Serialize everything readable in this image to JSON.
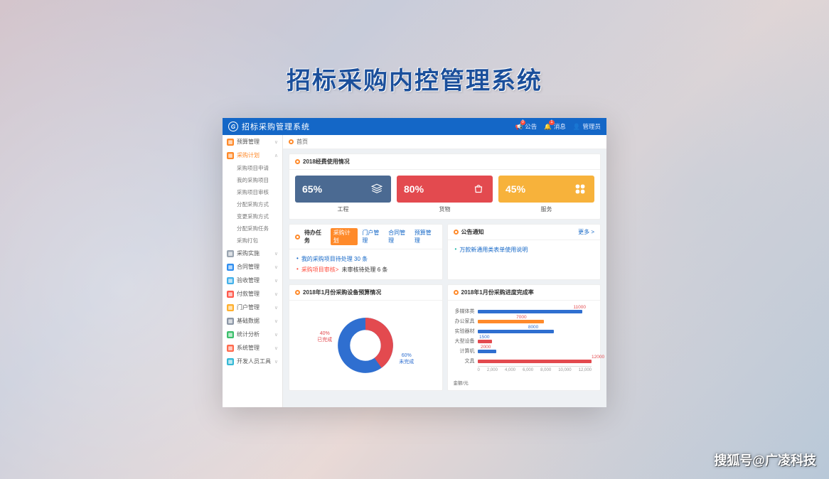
{
  "page_title": "招标采购内控管理系统",
  "watermark": "搜狐号@广凌科技",
  "titlebar": {
    "app_name": "招标采购管理系统",
    "notice": "公告",
    "notice_badge": "0",
    "msg": "消息",
    "msg_badge": "1",
    "user": "管理员"
  },
  "sidebar": {
    "items": [
      {
        "label": "预算管理",
        "icon_bg": "#ff8a2a",
        "chev": "∨"
      },
      {
        "label": "采购计划",
        "icon_bg": "#ff8a2a",
        "chev": "∧",
        "active": true,
        "children": [
          {
            "label": "采购项目申请"
          },
          {
            "label": "我的采购项目"
          },
          {
            "label": "采购项目审核"
          },
          {
            "label": "分配采购方式"
          },
          {
            "label": "变更采购方式"
          },
          {
            "label": "分配采购任务"
          },
          {
            "label": "采购打包"
          }
        ]
      },
      {
        "label": "采购实施",
        "icon_bg": "#9aa5b1",
        "chev": "∨"
      },
      {
        "label": "合同管理",
        "icon_bg": "#2f8ef0",
        "chev": "∨"
      },
      {
        "label": "验收管理",
        "icon_bg": "#44b1ea",
        "chev": "∨"
      },
      {
        "label": "付款管理",
        "icon_bg": "#ff5a4d",
        "chev": "∨"
      },
      {
        "label": "门户管理",
        "icon_bg": "#ffb02e",
        "chev": "∨"
      },
      {
        "label": "基础数据",
        "icon_bg": "#8c97a6",
        "chev": "∨"
      },
      {
        "label": "统计分析",
        "icon_bg": "#3bbf6b",
        "chev": "∨"
      },
      {
        "label": "系统管理",
        "icon_bg": "#ff6a4d",
        "chev": "∨"
      },
      {
        "label": "开发人员工具",
        "icon_bg": "#35b9d6",
        "chev": "∨"
      }
    ]
  },
  "crumb": "首页",
  "usage": {
    "title": "2018经费使用情况",
    "items": [
      {
        "pct": "65%",
        "label": "工程",
        "bg": "#4b6a92"
      },
      {
        "pct": "80%",
        "label": "货物",
        "bg": "#e34a4f"
      },
      {
        "pct": "45%",
        "label": "服务",
        "bg": "#f7b23b"
      }
    ]
  },
  "tasks": {
    "head": "待办任务",
    "tabs": [
      "采购计划",
      "门户管理",
      "合同管理",
      "预算管理"
    ],
    "active_tab": 0,
    "items": [
      {
        "text": "我的采购项目待处理 30 条",
        "color": "blue"
      },
      {
        "prefix": "采购项目审核>",
        "suffix": "未审核待处理 6 条",
        "color": "red"
      }
    ]
  },
  "notice_panel": {
    "title": "公告通知",
    "more": "更多 >",
    "items": [
      {
        "text": "万款新通用类表单使用说明"
      }
    ]
  },
  "chart_data": [
    {
      "type": "pie",
      "title": "2018年1月份采购设备预算情况",
      "series": [
        {
          "name": "已完成",
          "value": 40,
          "pct": "40%",
          "color": "#e34a4f"
        },
        {
          "name": "未完成",
          "value": 60,
          "pct": "60%",
          "color": "#2f6fd0"
        }
      ]
    },
    {
      "type": "bar",
      "title": "2018年1月份采购进度完成率",
      "xlabel": "金额/元",
      "xlim": [
        0,
        12000
      ],
      "ticks": [
        "0",
        "2,000",
        "4,000",
        "6,000",
        "8,000",
        "10,000",
        "12,000"
      ],
      "series": [
        {
          "name": "多媒体类",
          "value": 11000,
          "color": "#2f6fd0",
          "label_color": "#e34a4f"
        },
        {
          "name": "办公家具",
          "value": 7000,
          "color": "#ff8a2a",
          "label_color": "#e34a4f"
        },
        {
          "name": "实验器材",
          "value": 8000,
          "color": "#2f6fd0",
          "label_color": "#2f6fd0"
        },
        {
          "name": "大型设备",
          "value": 1500,
          "color": "#e34a4f",
          "label_color": "#2f6fd0"
        },
        {
          "name": "计算机",
          "value": 2000,
          "color": "#2f6fd0",
          "label_color": "#e34a4f"
        },
        {
          "name": "文具",
          "value": 12000,
          "color": "#e34a4f",
          "label_color": "#e34a4f"
        }
      ]
    }
  ]
}
